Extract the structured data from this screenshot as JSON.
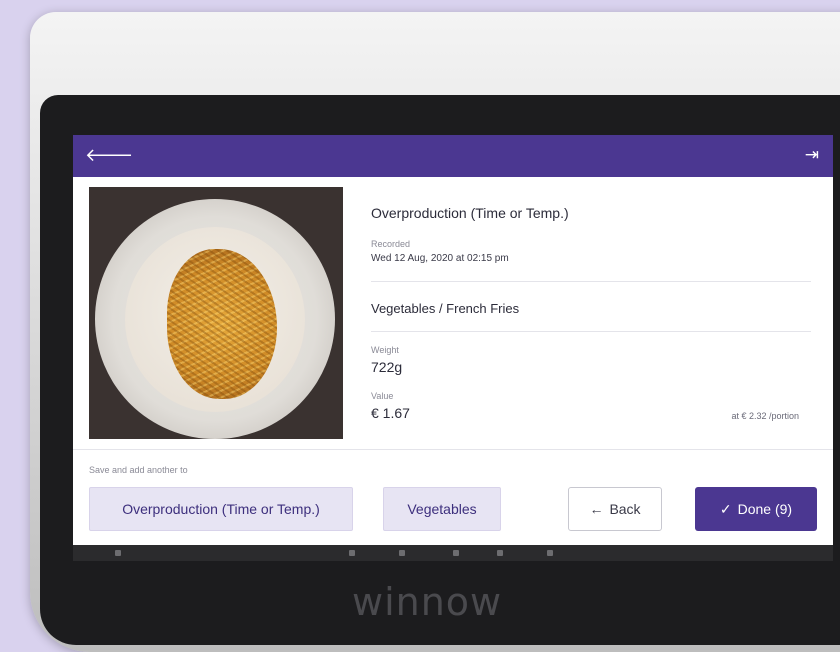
{
  "header": {
    "back_icon": "back-arrow-icon",
    "exit_icon": "exit-icon",
    "back_glyph": "🡐",
    "exit_glyph": "⇥"
  },
  "record": {
    "reason": "Overproduction (Time or Temp.)",
    "recorded_label": "Recorded",
    "recorded_value": "Wed 12 Aug, 2020 at 02:15 pm",
    "category": "Vegetables / French Fries",
    "weight_label": "Weight",
    "weight_value": "722g",
    "value_label": "Value",
    "value_value": "€ 1.67",
    "per_portion": "at € 2.32 /portion"
  },
  "footer": {
    "save_hint": "Save and add another to",
    "chip_reason": "Overproduction (Time or Temp.)",
    "chip_category": "Vegetables",
    "back_label": "Back",
    "back_glyph": "←",
    "done_label": "Done (9)",
    "done_glyph": "✓"
  },
  "device": {
    "brand": "winnow"
  },
  "colors": {
    "accent": "#4b3791",
    "chip_bg": "#e7e4f3",
    "background": "#d9d2ee"
  }
}
